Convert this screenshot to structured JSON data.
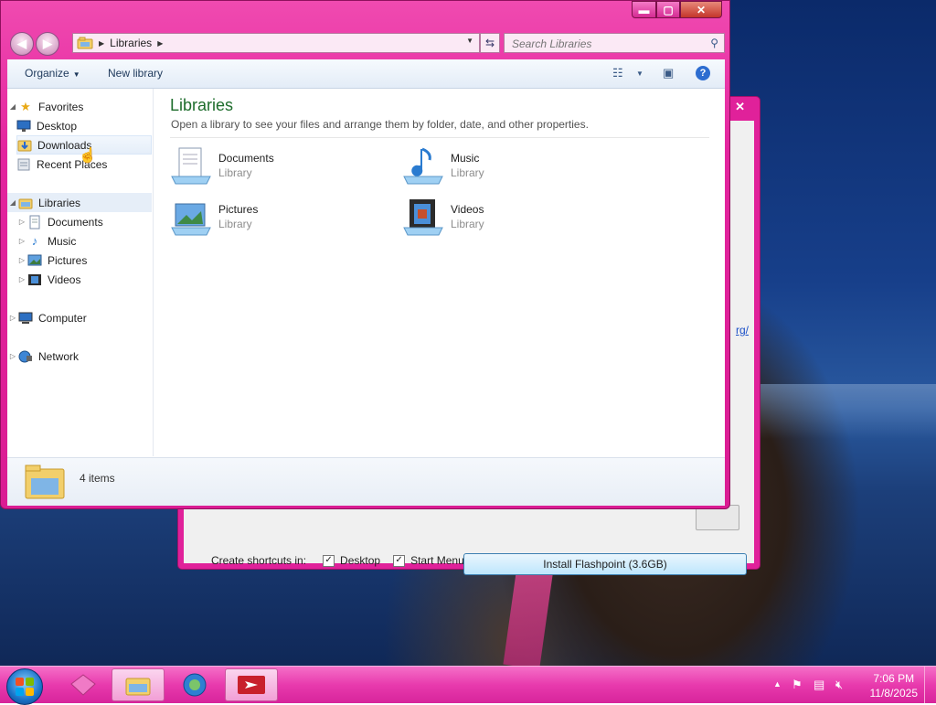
{
  "background_dialog": {
    "close_glyph": "✕",
    "link_text": "rg/",
    "shortcuts_label": "Create shortcuts in:",
    "desktop_label": "Desktop",
    "start_menu_label": "Start Menu",
    "desktop_checked": true,
    "start_menu_checked": true,
    "install_button": "Install Flashpoint (3.6GB)"
  },
  "explorer": {
    "caption_buttons": {
      "minimize": "▬",
      "maximize": "▢",
      "close": "✕"
    },
    "address": {
      "crumb": "Libraries"
    },
    "search": {
      "placeholder": "Search Libraries"
    },
    "toolbar": {
      "organize": "Organize",
      "new_library": "New library"
    },
    "nav": {
      "favorites": "Favorites",
      "desktop": "Desktop",
      "downloads": "Downloads",
      "recent_places": "Recent Places",
      "libraries": "Libraries",
      "documents": "Documents",
      "music": "Music",
      "pictures": "Pictures",
      "videos": "Videos",
      "computer": "Computer",
      "network": "Network"
    },
    "content": {
      "title": "Libraries",
      "description": "Open a library to see your files and arrange them by folder, date, and other properties.",
      "items": [
        {
          "name": "Documents",
          "type": "Library",
          "icon": "documents-library-icon"
        },
        {
          "name": "Music",
          "type": "Library",
          "icon": "music-library-icon"
        },
        {
          "name": "Pictures",
          "type": "Library",
          "icon": "pictures-library-icon"
        },
        {
          "name": "Videos",
          "type": "Library",
          "icon": "videos-library-icon"
        }
      ]
    },
    "details": {
      "count": "4 items"
    }
  },
  "taskbar": {
    "clock_time": "7:06 PM",
    "clock_date": "11/8/2025"
  },
  "colors": {
    "window_frame": "#e3249e",
    "taskbar": "#e83aad",
    "libraries_title": "#1e6d2c"
  }
}
